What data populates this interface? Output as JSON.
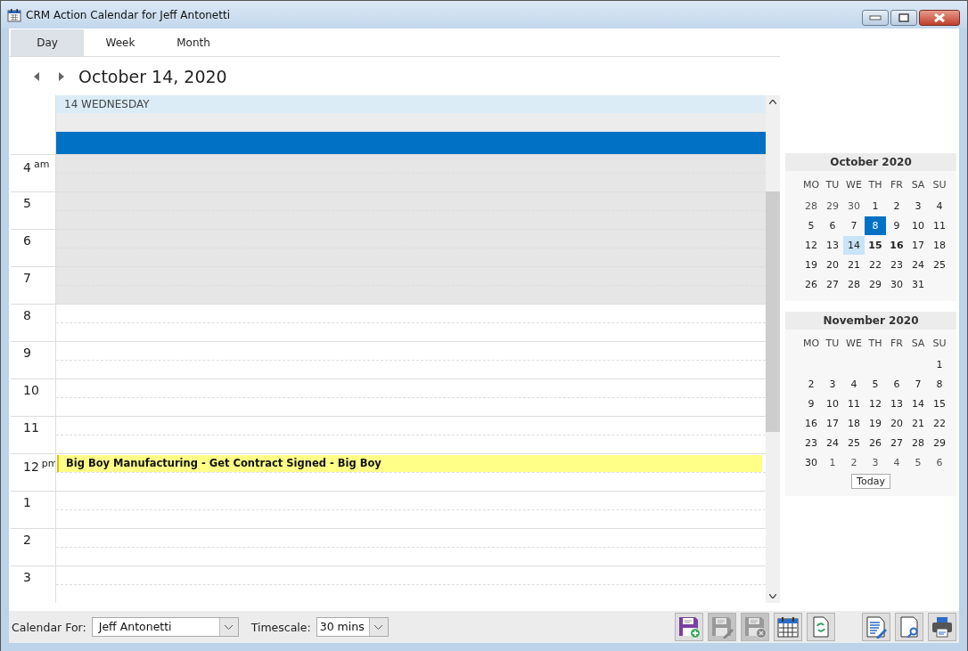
{
  "window": {
    "title": "CRM Action Calendar for Jeff Antonetti"
  },
  "tabs": [
    {
      "label": "Day",
      "selected": true
    },
    {
      "label": "Week",
      "selected": false
    },
    {
      "label": "Month",
      "selected": false
    }
  ],
  "date_heading": "October 14, 2020",
  "day_header": "14 WEDNESDAY",
  "all_day": {
    "selected": true
  },
  "hours": [
    {
      "label": "4",
      "suffix": "am",
      "working": false
    },
    {
      "label": "5",
      "working": false
    },
    {
      "label": "6",
      "working": false
    },
    {
      "label": "7",
      "working": false
    },
    {
      "label": "8",
      "working": true
    },
    {
      "label": "9",
      "working": true
    },
    {
      "label": "10",
      "working": true
    },
    {
      "label": "11",
      "working": true
    },
    {
      "label": "12",
      "suffix": "pm",
      "working": true,
      "events": [
        "Big Boy Manufacturing - Get Contract Signed - Big Boy"
      ]
    },
    {
      "label": "1",
      "working": true
    },
    {
      "label": "2",
      "working": true
    },
    {
      "label": "3",
      "working": true
    }
  ],
  "months": [
    {
      "title": "October 2020",
      "weekdays": [
        "MO",
        "TU",
        "WE",
        "TH",
        "FR",
        "SA",
        "SU"
      ],
      "weeks": [
        [
          {
            "label": "28",
            "other_month": true,
            "selected": false,
            "highlighted": false,
            "bold": false
          },
          {
            "label": "29",
            "other_month": true,
            "selected": false,
            "highlighted": false,
            "bold": false
          },
          {
            "label": "30",
            "other_month": true,
            "selected": false,
            "highlighted": false,
            "bold": false
          },
          {
            "label": "1",
            "other_month": false,
            "selected": false,
            "highlighted": false,
            "bold": false
          },
          {
            "label": "2",
            "other_month": false,
            "selected": false,
            "highlighted": false,
            "bold": false
          },
          {
            "label": "3",
            "other_month": false,
            "selected": false,
            "highlighted": false,
            "bold": false
          },
          {
            "label": "4",
            "other_month": false,
            "selected": false,
            "highlighted": false,
            "bold": false
          }
        ],
        [
          {
            "label": "5",
            "other_month": false,
            "selected": false,
            "highlighted": false,
            "bold": false
          },
          {
            "label": "6",
            "other_month": false,
            "selected": false,
            "highlighted": false,
            "bold": false
          },
          {
            "label": "7",
            "other_month": false,
            "selected": false,
            "highlighted": false,
            "bold": false
          },
          {
            "label": "8",
            "other_month": false,
            "selected": true,
            "highlighted": false,
            "bold": false
          },
          {
            "label": "9",
            "other_month": false,
            "selected": false,
            "highlighted": false,
            "bold": false
          },
          {
            "label": "10",
            "other_month": false,
            "selected": false,
            "highlighted": false,
            "bold": false
          },
          {
            "label": "11",
            "other_month": false,
            "selected": false,
            "highlighted": false,
            "bold": false
          }
        ],
        [
          {
            "label": "12",
            "other_month": false,
            "selected": false,
            "highlighted": false,
            "bold": false
          },
          {
            "label": "13",
            "other_month": false,
            "selected": false,
            "highlighted": false,
            "bold": false
          },
          {
            "label": "14",
            "other_month": false,
            "selected": false,
            "highlighted": true,
            "bold": false
          },
          {
            "label": "15",
            "other_month": false,
            "selected": false,
            "highlighted": false,
            "bold": true
          },
          {
            "label": "16",
            "other_month": false,
            "selected": false,
            "highlighted": false,
            "bold": true
          },
          {
            "label": "17",
            "other_month": false,
            "selected": false,
            "highlighted": false,
            "bold": false
          },
          {
            "label": "18",
            "other_month": false,
            "selected": false,
            "highlighted": false,
            "bold": false
          }
        ],
        [
          {
            "label": "19",
            "other_month": false,
            "selected": false,
            "highlighted": false,
            "bold": false
          },
          {
            "label": "20",
            "other_month": false,
            "selected": false,
            "highlighted": false,
            "bold": false
          },
          {
            "label": "21",
            "other_month": false,
            "selected": false,
            "highlighted": false,
            "bold": false
          },
          {
            "label": "22",
            "other_month": false,
            "selected": false,
            "highlighted": false,
            "bold": false
          },
          {
            "label": "23",
            "other_month": false,
            "selected": false,
            "highlighted": false,
            "bold": false
          },
          {
            "label": "24",
            "other_month": false,
            "selected": false,
            "highlighted": false,
            "bold": false
          },
          {
            "label": "25",
            "other_month": false,
            "selected": false,
            "highlighted": false,
            "bold": false
          }
        ],
        [
          {
            "label": "26",
            "other_month": false,
            "selected": false,
            "highlighted": false,
            "bold": false
          },
          {
            "label": "27",
            "other_month": false,
            "selected": false,
            "highlighted": false,
            "bold": false
          },
          {
            "label": "28",
            "other_month": false,
            "selected": false,
            "highlighted": false,
            "bold": false
          },
          {
            "label": "29",
            "other_month": false,
            "selected": false,
            "highlighted": false,
            "bold": false
          },
          {
            "label": "30",
            "other_month": false,
            "selected": false,
            "highlighted": false,
            "bold": false
          },
          {
            "label": "31",
            "other_month": false,
            "selected": false,
            "highlighted": false,
            "bold": false
          }
        ]
      ]
    },
    {
      "title": "November 2020",
      "weekdays": [
        "MO",
        "TU",
        "WE",
        "TH",
        "FR",
        "SA",
        "SU"
      ],
      "weeks": [
        [
          {
            "label": "1",
            "other_month": false,
            "selected": false,
            "highlighted": false,
            "bold": false
          }
        ],
        [
          {
            "label": "2",
            "other_month": false,
            "selected": false,
            "highlighted": false,
            "bold": false
          },
          {
            "label": "3",
            "other_month": false,
            "selected": false,
            "highlighted": false,
            "bold": false
          },
          {
            "label": "4",
            "other_month": false,
            "selected": false,
            "highlighted": false,
            "bold": false
          },
          {
            "label": "5",
            "other_month": false,
            "selected": false,
            "highlighted": false,
            "bold": false
          },
          {
            "label": "6",
            "other_month": false,
            "selected": false,
            "highlighted": false,
            "bold": false
          },
          {
            "label": "7",
            "other_month": false,
            "selected": false,
            "highlighted": false,
            "bold": false
          },
          {
            "label": "8",
            "other_month": false,
            "selected": false,
            "highlighted": false,
            "bold": false
          }
        ],
        [
          {
            "label": "9",
            "other_month": false,
            "selected": false,
            "highlighted": false,
            "bold": false
          },
          {
            "label": "10",
            "other_month": false,
            "selected": false,
            "highlighted": false,
            "bold": false
          },
          {
            "label": "11",
            "other_month": false,
            "selected": false,
            "highlighted": false,
            "bold": false
          },
          {
            "label": "12",
            "other_month": false,
            "selected": false,
            "highlighted": false,
            "bold": false
          },
          {
            "label": "13",
            "other_month": false,
            "selected": false,
            "highlighted": false,
            "bold": false
          },
          {
            "label": "14",
            "other_month": false,
            "selected": false,
            "highlighted": false,
            "bold": false
          },
          {
            "label": "15",
            "other_month": false,
            "selected": false,
            "highlighted": false,
            "bold": false
          }
        ],
        [
          {
            "label": "16",
            "other_month": false,
            "selected": false,
            "highlighted": false,
            "bold": false
          },
          {
            "label": "17",
            "other_month": false,
            "selected": false,
            "highlighted": false,
            "bold": false
          },
          {
            "label": "18",
            "other_month": false,
            "selected": false,
            "highlighted": false,
            "bold": false
          },
          {
            "label": "19",
            "other_month": false,
            "selected": false,
            "highlighted": false,
            "bold": false
          },
          {
            "label": "20",
            "other_month": false,
            "selected": false,
            "highlighted": false,
            "bold": false
          },
          {
            "label": "21",
            "other_month": false,
            "selected": false,
            "highlighted": false,
            "bold": false
          },
          {
            "label": "22",
            "other_month": false,
            "selected": false,
            "highlighted": false,
            "bold": false
          }
        ],
        [
          {
            "label": "23",
            "other_month": false,
            "selected": false,
            "highlighted": false,
            "bold": false
          },
          {
            "label": "24",
            "other_month": false,
            "selected": false,
            "highlighted": false,
            "bold": false
          },
          {
            "label": "25",
            "other_month": false,
            "selected": false,
            "highlighted": false,
            "bold": false
          },
          {
            "label": "26",
            "other_month": false,
            "selected": false,
            "highlighted": false,
            "bold": false
          },
          {
            "label": "27",
            "other_month": false,
            "selected": false,
            "highlighted": false,
            "bold": false
          },
          {
            "label": "28",
            "other_month": false,
            "selected": false,
            "highlighted": false,
            "bold": false
          },
          {
            "label": "29",
            "other_month": false,
            "selected": false,
            "highlighted": false,
            "bold": false
          }
        ],
        [
          {
            "label": "30",
            "other_month": false,
            "selected": false,
            "highlighted": false,
            "bold": false
          },
          {
            "label": "1",
            "other_month": true,
            "selected": false,
            "highlighted": false,
            "bold": false
          },
          {
            "label": "2",
            "other_month": true,
            "selected": false,
            "highlighted": false,
            "bold": false
          },
          {
            "label": "3",
            "other_month": true,
            "selected": false,
            "highlighted": false,
            "bold": false
          },
          {
            "label": "4",
            "other_month": true,
            "selected": false,
            "highlighted": false,
            "bold": false
          },
          {
            "label": "5",
            "other_month": true,
            "selected": false,
            "highlighted": false,
            "bold": false
          },
          {
            "label": "6",
            "other_month": true,
            "selected": false,
            "highlighted": false,
            "bold": false
          }
        ]
      ]
    }
  ],
  "today_button": "Today",
  "footer": {
    "calendar_for_label": "Calendar For:",
    "calendar_for_value": "Jeff Antonetti",
    "timescale_label": "Timescale:",
    "timescale_value": "30 mins"
  },
  "toolbar_groups": [
    [
      {
        "kind": "save-add",
        "disabled": false
      },
      {
        "kind": "save-edit",
        "disabled": true
      },
      {
        "kind": "save-delete",
        "disabled": true
      },
      {
        "kind": "calendar",
        "disabled": false
      },
      {
        "kind": "refresh",
        "disabled": false
      }
    ],
    [
      {
        "kind": "document-edit",
        "disabled": false
      },
      {
        "kind": "preview",
        "disabled": false
      },
      {
        "kind": "print",
        "disabled": false
      }
    ]
  ]
}
